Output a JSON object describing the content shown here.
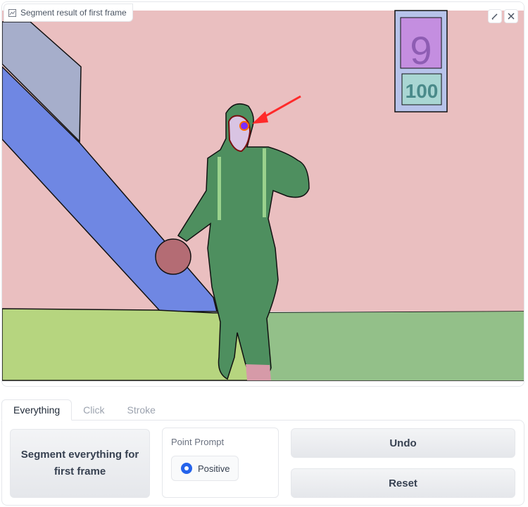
{
  "image_panel": {
    "label": "Segment result of first frame",
    "label_icon": "image-icon",
    "edit_icon": "pencil-icon",
    "close_icon": "close-icon",
    "scoreboard_number": "100",
    "scoreboard_letter": "9"
  },
  "tabs": [
    {
      "label": "Everything",
      "active": true
    },
    {
      "label": "Click",
      "active": false
    },
    {
      "label": "Stroke",
      "active": false
    }
  ],
  "everything_tab": {
    "segment_button": "Segment everything for first frame",
    "point_prompt": {
      "title": "Point Prompt",
      "option": "Positive",
      "selected": true
    },
    "undo_button": "Undo",
    "reset_button": "Reset"
  },
  "colors": {
    "accent": "#2563eb",
    "arrow": "#ff2a2a",
    "wall": "#eabfc0",
    "floor_left": "#b6d57f",
    "floor_right": "#93c089",
    "ramp": "#6f87e3",
    "person": "#4e8f5f"
  }
}
